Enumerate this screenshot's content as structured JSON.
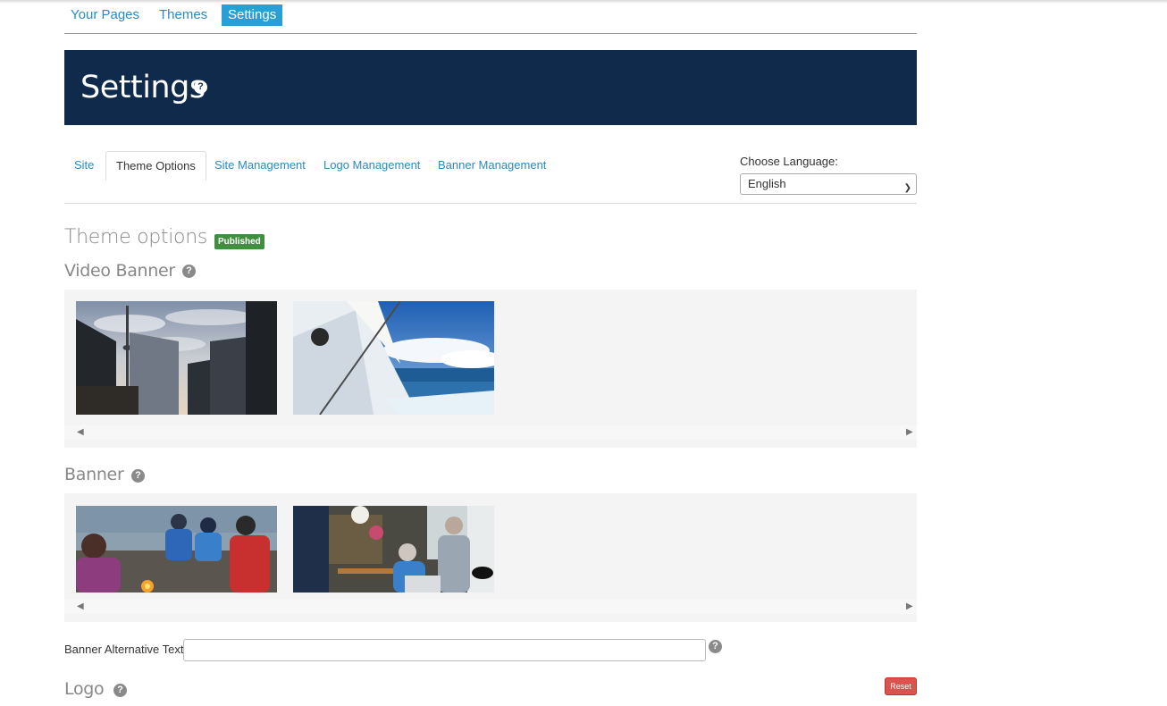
{
  "top_nav": {
    "items": [
      {
        "label": "Your Pages"
      },
      {
        "label": "Themes"
      },
      {
        "label": "Settings",
        "active": true
      }
    ]
  },
  "header": {
    "title": "Settings",
    "help_icon": "question-circle-icon"
  },
  "tabs": [
    {
      "label": "Site"
    },
    {
      "label": "Theme Options",
      "active": true
    },
    {
      "label": "Site Management"
    },
    {
      "label": "Logo Management"
    },
    {
      "label": "Banner Management"
    }
  ],
  "language": {
    "label": "Choose Language:",
    "selected": "English"
  },
  "theme_options": {
    "title": "Theme options",
    "status_badge": "Published"
  },
  "video_banner": {
    "title": "Video Banner",
    "images": [
      {
        "description": "City skyline with CN Tower"
      },
      {
        "description": "Sailboat on open water"
      }
    ]
  },
  "banner": {
    "title": "Banner",
    "images": [
      {
        "description": "Friends around a campfire by a lake"
      },
      {
        "description": "Senior couple cooking in kitchen"
      }
    ]
  },
  "banner_alt": {
    "label": "Banner Alternative Text",
    "value": ""
  },
  "logo": {
    "title": "Logo",
    "reset_label": "Reset"
  },
  "colors": {
    "header_bg": "#0f2a4a",
    "link": "#2a8bc4",
    "active_nav": "#2a9fd6",
    "badge_green": "#3e8f3e",
    "reset_red": "#d9534f"
  }
}
